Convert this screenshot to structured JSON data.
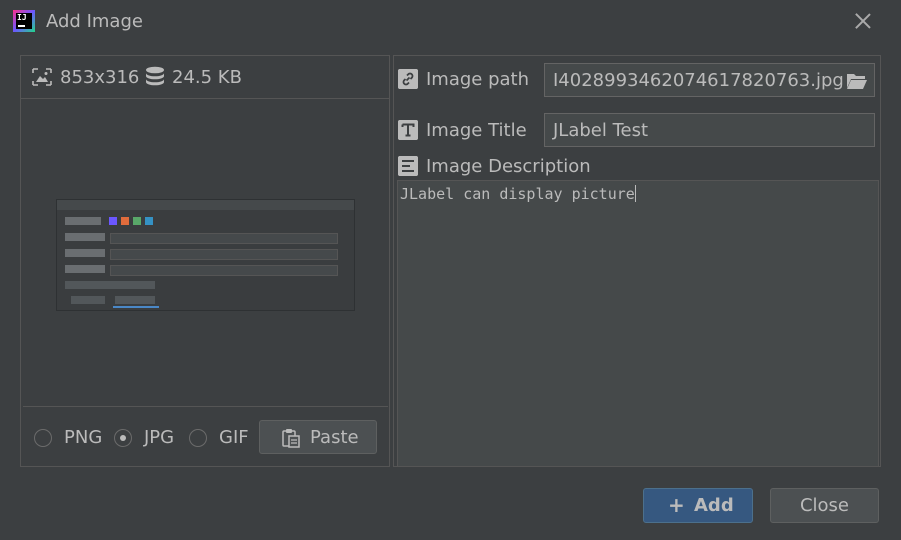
{
  "window": {
    "title": "Add Image"
  },
  "image_info": {
    "dimensions": "853x316",
    "size": "24.5 KB"
  },
  "formats": {
    "options": [
      "PNG",
      "JPG",
      "GIF"
    ],
    "selected": "JPG",
    "paste_label": "Paste"
  },
  "fields": {
    "path_label": "Image path",
    "path_value": "I4028993462074617820763.jpg",
    "title_label": "Image Title",
    "title_value": "JLabel Test",
    "description_label": "Image Description",
    "description_value": "JLabel can display picture"
  },
  "buttons": {
    "add_label": "Add",
    "close_label": "Close"
  },
  "colors": {
    "background": "#3c3f41",
    "accent": "#365880",
    "text": "#bbbbbb"
  }
}
